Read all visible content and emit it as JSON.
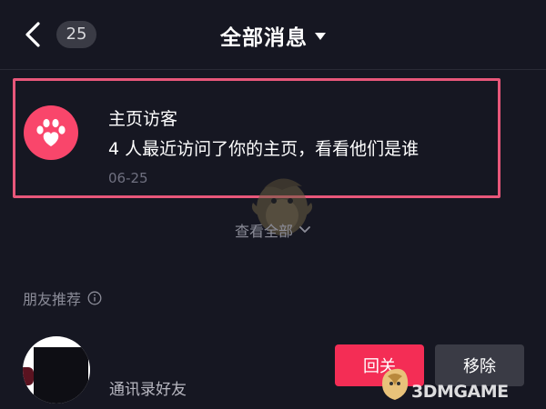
{
  "header": {
    "back_icon": "chevron-left-icon",
    "unread_count": "25",
    "title": "全部消息",
    "title_caret_icon": "caret-down-icon"
  },
  "visitor_notice": {
    "icon": "paw-icon",
    "icon_bg_color": "#f9466b",
    "title": "主页访客",
    "description": "4 人最近访问了你的主页，看看他们是谁",
    "date": "06-25",
    "highlight_color": "#e8577a"
  },
  "view_all": {
    "label": "查看全部",
    "icon": "chevron-down-icon"
  },
  "friend_recommend": {
    "section_title": "朋友推荐",
    "info_icon": "info-icon",
    "items": [
      {
        "description": "通讯录好友",
        "follow_label": "回关",
        "remove_label": "移除"
      }
    ]
  },
  "colors": {
    "background": "#161722",
    "accent": "#f42d55",
    "secondary_button": "#3a3b45"
  },
  "watermark": {
    "logo_text": "3DMGAME"
  }
}
